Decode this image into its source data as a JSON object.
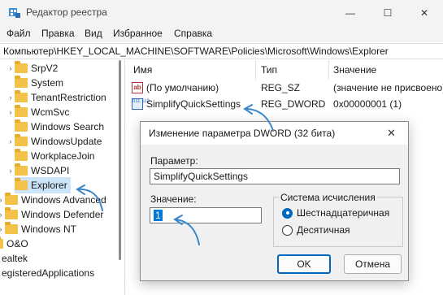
{
  "window": {
    "title": "Редактор реестра",
    "minimize": "—",
    "maximize": "☐",
    "close": "✕"
  },
  "menu": [
    "Файл",
    "Правка",
    "Вид",
    "Избранное",
    "Справка"
  ],
  "address": "Компьютер\\HKEY_LOCAL_MACHINE\\SOFTWARE\\Policies\\Microsoft\\Windows\\Explorer",
  "tree": [
    {
      "label": "SrpV2",
      "chevron": "›"
    },
    {
      "label": "System",
      "chevron": ""
    },
    {
      "label": "TenantRestriction",
      "chevron": "›"
    },
    {
      "label": "WcmSvc",
      "chevron": "›"
    },
    {
      "label": "Windows Search",
      "chevron": ""
    },
    {
      "label": "WindowsUpdate",
      "chevron": "›"
    },
    {
      "label": "WorkplaceJoin",
      "chevron": ""
    },
    {
      "label": "WSDAPI",
      "chevron": "›"
    },
    {
      "label": "Explorer",
      "chevron": "",
      "selected": true
    },
    {
      "label": "Windows Advanced",
      "chevron": "›"
    },
    {
      "label": "Windows Defender",
      "chevron": "›"
    },
    {
      "label": "Windows NT",
      "chevron": "›"
    },
    {
      "label": "O&O",
      "chevron": ""
    },
    {
      "label": "ealtek",
      "chevron": ""
    },
    {
      "label": "egisteredApplications",
      "chevron": ""
    }
  ],
  "list": {
    "columns": [
      "Имя",
      "Тип",
      "Значение"
    ],
    "rows": [
      {
        "icon": "string-value-icon",
        "icon_text": "ab",
        "name": "(По умолчанию)",
        "type": "REG_SZ",
        "value": "(значение не присвоено)"
      },
      {
        "icon": "dword-value-icon",
        "icon_text": "011 110",
        "name": "SimplifyQuickSettings",
        "type": "REG_DWORD",
        "value": "0x00000001 (1)"
      }
    ]
  },
  "dialog": {
    "title": "Изменение параметра DWORD (32 бита)",
    "close": "✕",
    "param_label": "Параметр:",
    "param_value": "SimplifyQuickSettings",
    "value_label": "Значение:",
    "value_value": "1",
    "base_label": "Система исчисления",
    "radio_hex": "Шестнадцатеричная",
    "radio_dec": "Десятичная",
    "selected_base": "hex",
    "ok": "OK",
    "cancel": "Отмена"
  },
  "colors": {
    "accent": "#0067c0",
    "arrow": "#3a86c8",
    "selection": "#cce4f7",
    "folder": "#f2c24a"
  }
}
